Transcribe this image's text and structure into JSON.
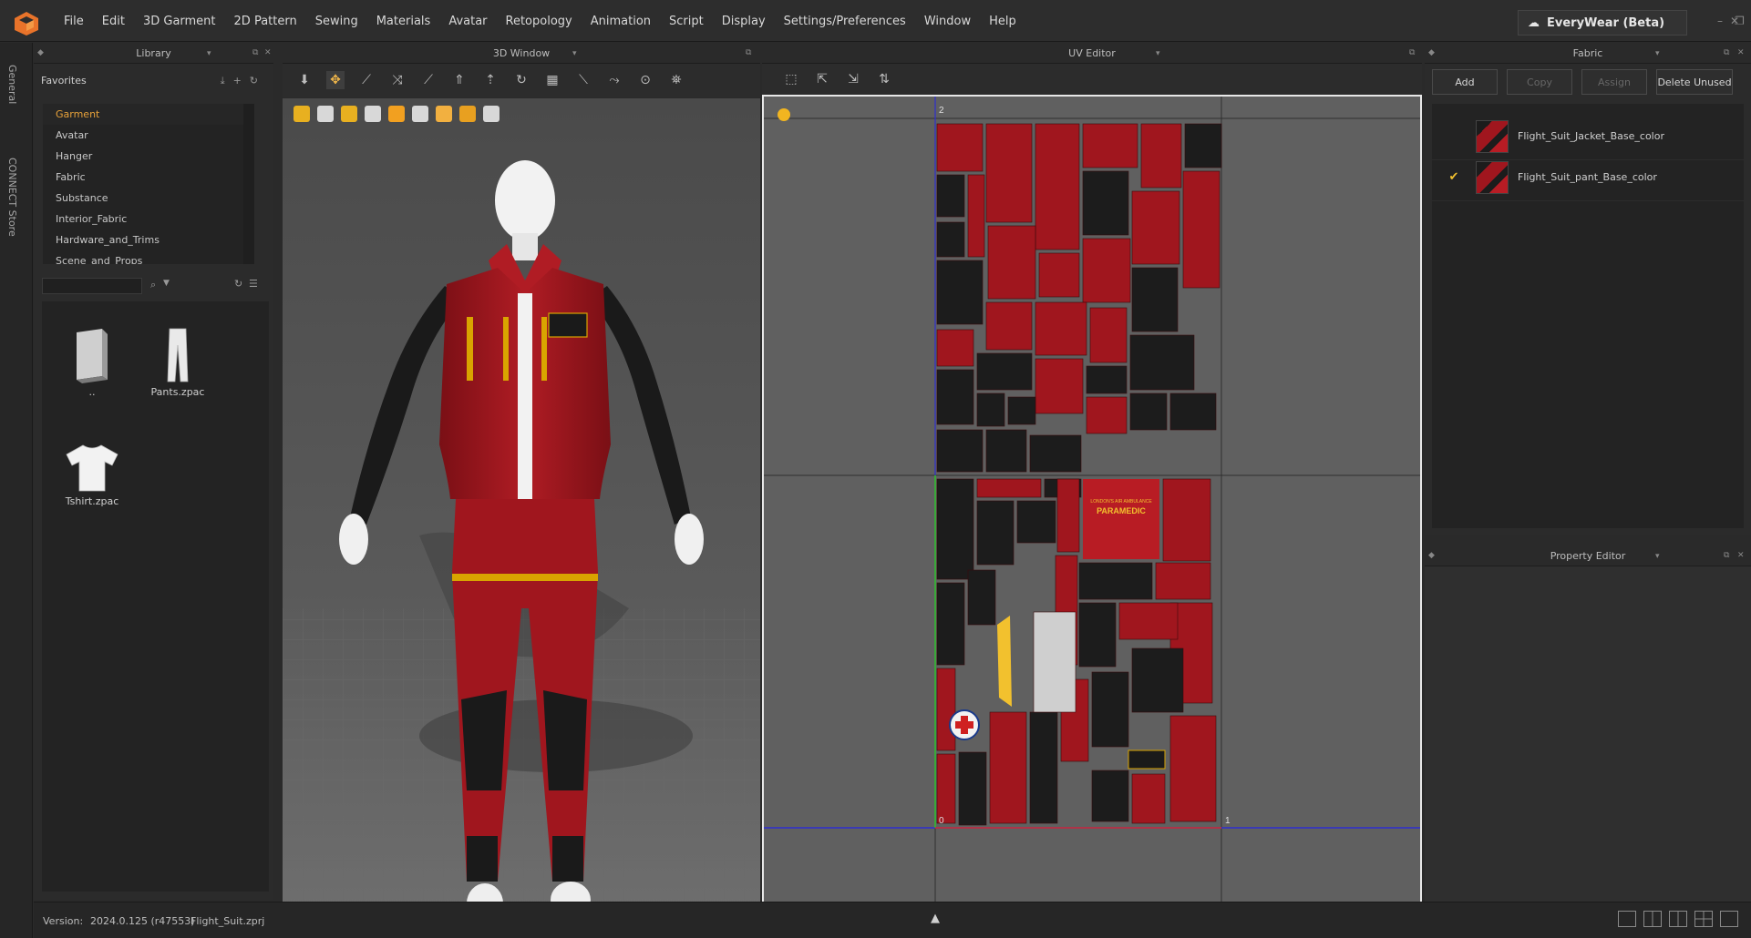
{
  "app": {
    "brand": "EveryWear (Beta)",
    "menu": [
      "File",
      "Edit",
      "3D Garment",
      "2D Pattern",
      "Sewing",
      "Materials",
      "Avatar",
      "Retopology",
      "Animation",
      "Script",
      "Display",
      "Settings/Preferences",
      "Window",
      "Help"
    ]
  },
  "side_tabs": [
    "General",
    "CONNECT Store"
  ],
  "library": {
    "title": "Library",
    "favorites_label": "Favorites",
    "favorites": [
      "Garment",
      "Avatar",
      "Hanger",
      "Fabric",
      "Substance",
      "Interior_Fabric",
      "Hardware_and_Trims",
      "Scene_and_Props"
    ],
    "selected": "Garment",
    "search_value": "",
    "files": [
      {
        "label": "..",
        "icon": "folder-up-icon"
      },
      {
        "label": "Pants.zpac",
        "icon": "pants-icon"
      },
      {
        "label": "Tshirt.zpac",
        "icon": "tshirt-icon"
      }
    ]
  },
  "window3d": {
    "title": "3D Window",
    "tools": [
      "pointer-down-icon",
      "transform-pin-icon",
      "select-icon",
      "fold-icon",
      "measure-icon",
      "sew-icon",
      "tack-icon",
      "pin-icon",
      "grid-icon",
      "brush-icon",
      "steam-icon",
      "stitch-icon",
      "trim-icon"
    ],
    "mini_tools": [
      "avatar-view-icon",
      "garment-view-icon",
      "fabric-view-icon",
      "avatar-skin-icon",
      "texture-icon",
      "thickness-icon",
      "light-icon",
      "globe-icon",
      "export-icon"
    ]
  },
  "uv_editor": {
    "title": "UV Editor",
    "tools": [
      "uv-select-icon",
      "uv-move-icon",
      "uv-arrange-icon",
      "uv-pack-icon"
    ],
    "labels": {
      "top_tile": "2",
      "origin": "0",
      "right_tile": "1"
    },
    "patch_text": {
      "title": "PARAMEDIC",
      "subtitle": "LONDON'S AIR AMBULANCE"
    }
  },
  "fabric": {
    "title": "Fabric",
    "buttons": {
      "add": "Add",
      "copy": "Copy",
      "assign": "Assign",
      "delete_unused": "Delete Unused"
    },
    "items": [
      {
        "name": "Flight_Suit_Jacket_Base_color",
        "checked": false
      },
      {
        "name": "Flight_Suit_pant_Base_color",
        "checked": true
      }
    ]
  },
  "property_editor": {
    "title": "Property Editor"
  },
  "status": {
    "version_label": "Version:",
    "version": "2024.0.125 (r47553)",
    "file": "Flight_Suit.zprj"
  },
  "colors": {
    "accent": "#e8a23a",
    "suit_red": "#a0161e",
    "suit_black": "#1c1c1c",
    "stripe_yellow": "#d9a400"
  }
}
